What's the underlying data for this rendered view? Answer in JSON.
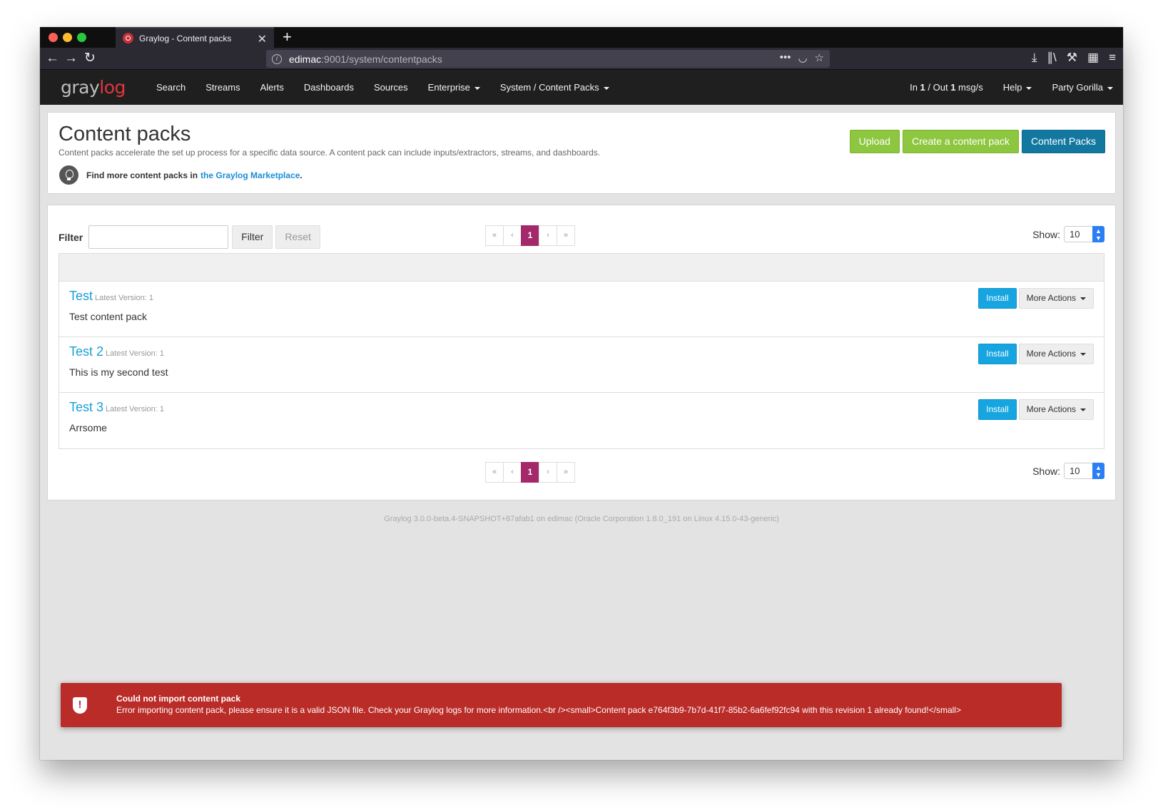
{
  "browser": {
    "tab_title": "Graylog - Content packs",
    "url_host": "edimac",
    "url_path": ":9001/system/contentpacks"
  },
  "nav": {
    "logo_gray": "gray",
    "logo_red": "log",
    "items": [
      "Search",
      "Streams",
      "Alerts",
      "Dashboards",
      "Sources",
      "Enterprise",
      "System / Content Packs"
    ],
    "throughput": {
      "pre": "In ",
      "in": "1",
      "mid": " / Out ",
      "out": "1",
      "post": " msg/s"
    },
    "help": "Help",
    "user": "Party Gorilla"
  },
  "header": {
    "title": "Content packs",
    "description": "Content packs accelerate the set up process for a specific data source. A content pack can include inputs/extractors, streams, and dashboards.",
    "hint_text": "Find more content packs in",
    "hint_link": "the Graylog Marketplace",
    "hint_suffix": ".",
    "buttons": {
      "upload": "Upload",
      "create": "Create a content pack",
      "content_packs": "Content Packs"
    }
  },
  "list": {
    "filter_label": "Filter",
    "filter_button": "Filter",
    "reset_button": "Reset",
    "pager": {
      "first": "«",
      "prev": "‹",
      "current": "1",
      "next": "›",
      "last": "»"
    },
    "show_label": "Show:",
    "show_value": "10",
    "rows": [
      {
        "title": "Test",
        "version": "Latest Version: 1",
        "description": "Test content pack"
      },
      {
        "title": "Test 2",
        "version": "Latest Version: 1",
        "description": "This is my second test"
      },
      {
        "title": "Test 3",
        "version": "Latest Version: 1",
        "description": "Arrsome"
      }
    ],
    "install_label": "Install",
    "more_actions_label": "More Actions"
  },
  "footer": "Graylog 3.0.0-beta.4-SNAPSHOT+87afab1 on edimac (Oracle Corporation 1.8.0_191 on Linux 4.15.0-43-generic)",
  "alert": {
    "title": "Could not import content pack",
    "message": "Error importing content pack, please ensure it is a valid JSON file. Check your Graylog logs for more information.<br /><small>Content pack e764f3b9-7b7d-41f7-85b2-6a6fef92fc94 with this revision 1 already found!</small>"
  },
  "colors": {
    "accent_green": "#8dc63f",
    "accent_blue": "#1378a0",
    "pager_active": "#a4296a",
    "alert_red": "#b92c28",
    "link_blue": "#1a9fd6"
  },
  "icons": [
    "graylog-favicon",
    "close-icon",
    "new-tab-icon",
    "back-arrow-icon",
    "forward-arrow-icon",
    "reload-icon",
    "site-info-icon",
    "more-icon",
    "pocket-icon",
    "star-icon",
    "download-icon",
    "library-icon",
    "wrench-icon",
    "extensions-icon",
    "menu-icon",
    "lightbulb-icon",
    "shield-icon"
  ]
}
